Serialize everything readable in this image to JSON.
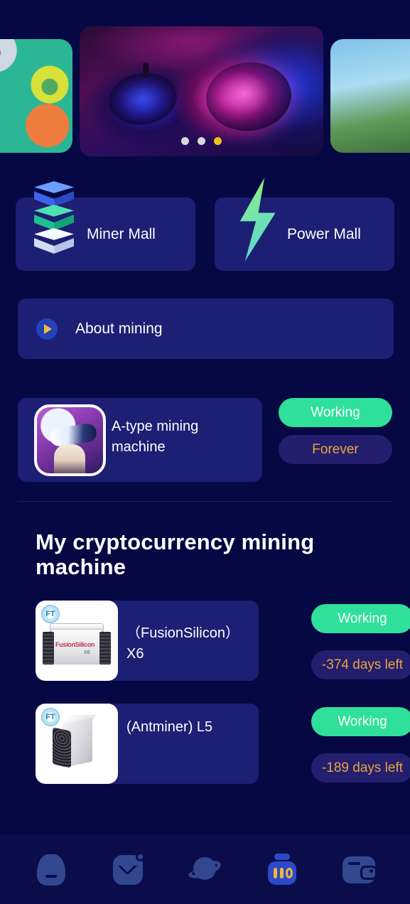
{
  "theme": {
    "background": "#050842",
    "card": "#1c1f73",
    "accent_green": "#2ee09a",
    "accent_orange": "#e8a43c",
    "accent_yellow": "#f2c21b",
    "nav_bar": "#0a0d4a",
    "nav_icon": "#33478f",
    "nav_active": "#2c49c9"
  },
  "carousel": {
    "slides": [
      {
        "name": "app-icons-slide"
      },
      {
        "name": "vr-headset-slide"
      },
      {
        "name": "landscape-slide"
      }
    ],
    "dots": [
      {
        "active": false
      },
      {
        "active": false
      },
      {
        "active": true
      }
    ],
    "active_index": 2
  },
  "malls": [
    {
      "label": "Miner Mall",
      "icon": "stacked-cubes-icon"
    },
    {
      "label": "Power Mall",
      "icon": "lightning-bolt-icon"
    }
  ],
  "about": {
    "label": "About mining",
    "icon": "play-icon"
  },
  "featured_machine": {
    "name": "A-type mining machine",
    "thumbnail": "vr-avatar-thumbnail",
    "status": "Working",
    "duration": "Forever"
  },
  "section": {
    "title": "My cryptocurrency mining machine"
  },
  "machines": [
    {
      "name": "（FusionSilicon）X6",
      "thumbnail": "fusionsilicon-x6-thumbnail",
      "badge": "FT",
      "brand_text": "FusionSilicon",
      "model_text": "X6",
      "status": "Working",
      "days_left": "-374 days left"
    },
    {
      "name": "(Antminer) L5",
      "thumbnail": "antminer-l5-thumbnail",
      "badge": "FT",
      "status": "Working",
      "days_left": "-189 days left"
    }
  ],
  "tabbar": {
    "items": [
      {
        "name": "home-icon",
        "active": false
      },
      {
        "name": "chart-icon",
        "active": false
      },
      {
        "name": "planet-icon",
        "active": false
      },
      {
        "name": "miner-icon",
        "active": true
      },
      {
        "name": "wallet-icon",
        "active": false
      }
    ]
  }
}
